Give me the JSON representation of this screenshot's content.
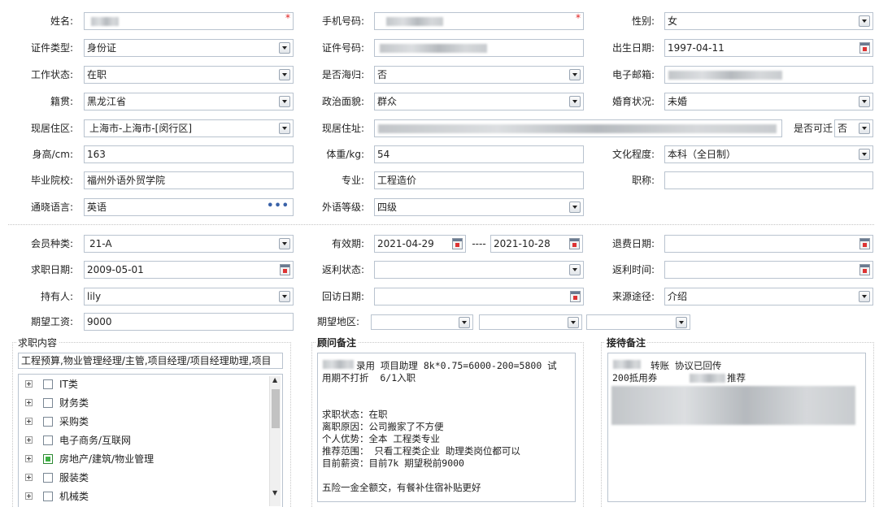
{
  "form": {
    "name": {
      "label": "姓名:",
      "required": "*"
    },
    "mobile": {
      "label": "手机号码:",
      "required": "*"
    },
    "gender": {
      "label": "性别:",
      "value": "女"
    },
    "id_type": {
      "label": "证件类型:",
      "value": "身份证"
    },
    "id_number": {
      "label": "证件号码:"
    },
    "birth_date": {
      "label": "出生日期:",
      "value": "1997-04-11"
    },
    "work_status": {
      "label": "工作状态:",
      "value": "在职"
    },
    "returnee": {
      "label": "是否海归:",
      "value": "否"
    },
    "email": {
      "label": "电子邮箱:"
    },
    "native_place": {
      "label": "籍贯:",
      "value": "黑龙江省"
    },
    "political": {
      "label": "政治面貌:",
      "value": "群众"
    },
    "marital": {
      "label": "婚育状况:",
      "value": "未婚"
    },
    "residence_area": {
      "label": "现居住区:",
      "value": "上海市-上海市-[闵行区]"
    },
    "address": {
      "label": "现居住址:"
    },
    "relocate": {
      "label": "是否可迁",
      "value": "否"
    },
    "height": {
      "label": "身高/cm:",
      "value": "163"
    },
    "weight": {
      "label": "体重/kg:",
      "value": "54"
    },
    "education": {
      "label": "文化程度:",
      "value": "本科（全日制）"
    },
    "school": {
      "label": "毕业院校:",
      "value": "福州外语外贸学院"
    },
    "major": {
      "label": "专业:",
      "value": "工程造价"
    },
    "title": {
      "label": "职称:",
      "value": ""
    },
    "language": {
      "label": "通晓语言:",
      "value": "英语",
      "more": "•••"
    },
    "language_level": {
      "label": "外语等级:",
      "value": "四级"
    },
    "member_type": {
      "label": "会员种类:",
      "value": "21-A"
    },
    "validity": {
      "label": "有效期:",
      "start": "2021-04-29",
      "sep": "----",
      "end": "2021-10-28"
    },
    "refund_date": {
      "label": "退费日期:",
      "value": ""
    },
    "job_date": {
      "label": "求职日期:",
      "value": "2009-05-01"
    },
    "rebate_status": {
      "label": "返利状态:",
      "value": ""
    },
    "rebate_time": {
      "label": "返利时间:",
      "value": ""
    },
    "holder": {
      "label": "持有人:",
      "value": "lily"
    },
    "visit_date": {
      "label": "回访日期:",
      "value": ""
    },
    "source": {
      "label": "来源途径:",
      "value": "介绍"
    },
    "salary": {
      "label": "期望工资:",
      "value": "9000"
    },
    "region": {
      "label": "期望地区:"
    }
  },
  "job_panel": {
    "title": "求职内容",
    "selected": "工程预算,物业管理经理/主管,项目经理/项目经理助理,项目",
    "tree": [
      {
        "label": "IT类",
        "checked": false
      },
      {
        "label": "财务类",
        "checked": false
      },
      {
        "label": "采购类",
        "checked": false
      },
      {
        "label": "电子商务/互联网",
        "checked": false
      },
      {
        "label": "房地产/建筑/物业管理",
        "checked": true
      },
      {
        "label": "服装类",
        "checked": false
      },
      {
        "label": "机械类",
        "checked": false
      }
    ]
  },
  "advisor_panel": {
    "title": "顾问备注",
    "text": "录用 项目助理 8k*0.75=6000-200=5800 试\n用期不打折  6/1入职\n\n\n求职状态：在职\n离职原因：公司搬家了不方便\n个人优势：全本 工程类专业\n推荐范围： 只看工程类企业 助理类岗位都可以\n目前薪资：目前7k 期望税前9000\n\n五险一金全额交，有餐补住宿补贴更好"
  },
  "reception_panel": {
    "title": "接待备注",
    "line1": "转账 协议已回传",
    "line2a": "200抵用券",
    "line2b": "推荐"
  }
}
